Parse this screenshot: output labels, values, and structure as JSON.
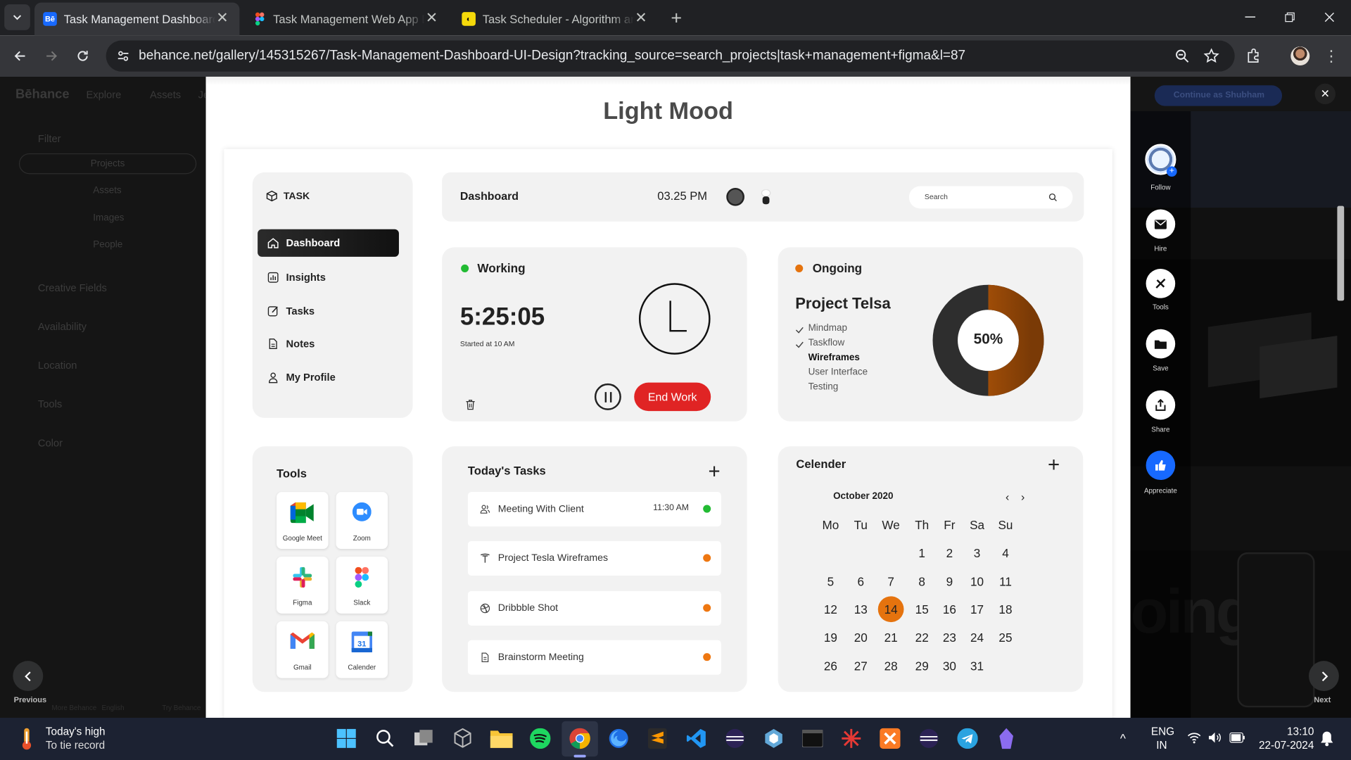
{
  "tabs": [
    {
      "title": "Task Management Dashboard U",
      "favicon": "behance"
    },
    {
      "title": "Task Management Web App De",
      "favicon": "figma"
    },
    {
      "title": "Task Scheduler - Algorithm and",
      "favicon": "algo"
    }
  ],
  "address": {
    "url": "behance.net/gallery/145315267/Task-Management-Dashboard-UI-Design?tracking_source=search_projects|task+management+figma&l=87"
  },
  "behance": {
    "logo": "Bēhance",
    "nav": [
      "Explore",
      "Assets",
      "Je"
    ],
    "filter_label": "Filter",
    "search_tabs": [
      "Projects",
      "Assets",
      "Images",
      "People"
    ],
    "filters": [
      "Creative Fields",
      "Availability",
      "Location",
      "Tools",
      "Color"
    ],
    "previous_label": "Previous",
    "next_label": "Next",
    "footer_links": [
      "More Behance",
      "English",
      "Try Behance"
    ],
    "continue_label": "Continue as Shubham",
    "side_actions": [
      "Follow",
      "Hire",
      "Tools",
      "Save",
      "Share",
      "Appreciate"
    ]
  },
  "page": {
    "section_title": "Light Mood"
  },
  "app": {
    "brand": "TASK",
    "nav": [
      {
        "label": "Dashboard",
        "icon": "home-icon"
      },
      {
        "label": "Insights",
        "icon": "chart-icon"
      },
      {
        "label": "Tasks",
        "icon": "edit-icon"
      },
      {
        "label": "Notes",
        "icon": "note-icon"
      },
      {
        "label": "My Profile",
        "icon": "user-icon"
      }
    ],
    "header": {
      "title": "Dashboard",
      "time": "03.25 PM",
      "search_placeholder": "Search"
    },
    "working": {
      "status": "Working",
      "timer": "5:25:05",
      "started": "Started at 10 AM",
      "end_label": "End Work"
    },
    "ongoing": {
      "status": "Ongoing",
      "project": "Project Telsa",
      "steps": [
        {
          "label": "Mindmap",
          "done": true
        },
        {
          "label": "Taskflow",
          "done": true
        },
        {
          "label": "Wireframes",
          "done": false,
          "current": true
        },
        {
          "label": "User Interface",
          "done": false
        },
        {
          "label": "Testing",
          "done": false
        }
      ],
      "progress": 50,
      "progress_label": "50%"
    },
    "tools": {
      "title": "Tools",
      "items": [
        "Google Meet",
        "Zoom",
        "Figma",
        "Slack",
        "Gmail",
        "Calender"
      ]
    },
    "tasks": {
      "title": "Today's Tasks",
      "items": [
        {
          "label": "Meeting With Client",
          "time": "11:30 AM",
          "status_color": "#22bb33",
          "icon": "users-icon"
        },
        {
          "label": "Project Tesla Wireframes",
          "time": "",
          "status_color": "#ee7711",
          "icon": "tesla-icon"
        },
        {
          "label": "Dribbble Shot",
          "time": "",
          "status_color": "#ee7711",
          "icon": "dribbble-icon"
        },
        {
          "label": "Brainstorm Meeting",
          "time": "",
          "status_color": "#ee7711",
          "icon": "document-icon"
        }
      ]
    },
    "calendar": {
      "title": "Celender",
      "month": "October 2020",
      "weekdays": [
        "Mo",
        "Tu",
        "We",
        "Th",
        "Fr",
        "Sa",
        "Su"
      ],
      "weeks": [
        [
          "",
          "",
          "",
          "1",
          "2",
          "3",
          "4"
        ],
        [
          "5",
          "6",
          "7",
          "8",
          "9",
          "10",
          "11"
        ],
        [
          "12",
          "13",
          "14",
          "15",
          "16",
          "17",
          "18"
        ],
        [
          "19",
          "20",
          "21",
          "22",
          "23",
          "24",
          "25"
        ],
        [
          "26",
          "27",
          "28",
          "29",
          "30",
          "31",
          ""
        ]
      ],
      "selected": "14"
    }
  },
  "taskbar": {
    "weather_title": "Today's high",
    "weather_sub": "To tie record",
    "lang": "ENG",
    "region": "IN",
    "time": "13:10",
    "date": "22-07-2024"
  },
  "colors": {
    "accent_orange": "#e5730e",
    "end_work_red": "#e02424",
    "working_green": "#22bb33",
    "dark": "#2e2e2e"
  }
}
